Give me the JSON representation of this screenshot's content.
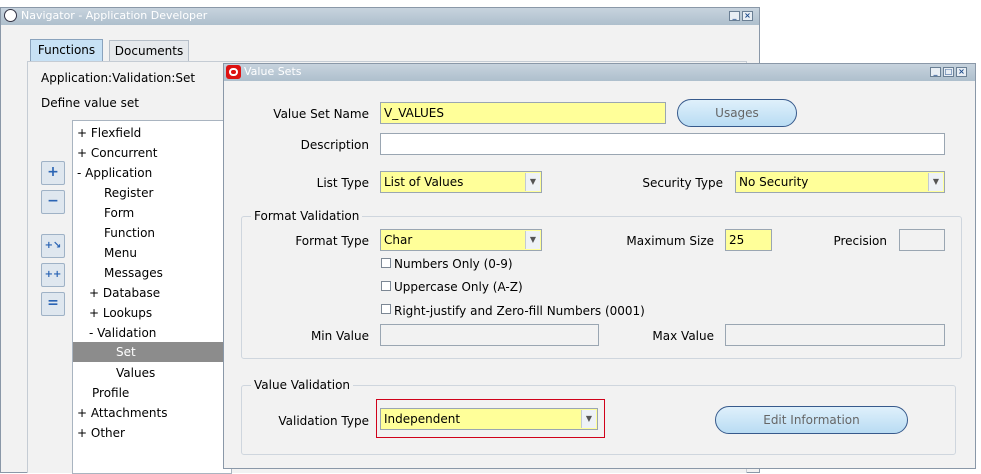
{
  "navigator": {
    "title": "Navigator - Application Developer",
    "tabs": [
      "Functions",
      "Documents"
    ],
    "path": "Application:Validation:Set",
    "description": "Define value set",
    "tree": [
      {
        "label": "+ Flexfield"
      },
      {
        "label": "+ Concurrent"
      },
      {
        "label": "- Application"
      },
      {
        "label": "Register"
      },
      {
        "label": "Form"
      },
      {
        "label": "Function"
      },
      {
        "label": "Menu"
      },
      {
        "label": "Messages"
      },
      {
        "label": "+ Database"
      },
      {
        "label": "+ Lookups"
      },
      {
        "label": "- Validation"
      },
      {
        "label": "Set"
      },
      {
        "label": "Values"
      },
      {
        "label": "Profile"
      },
      {
        "label": "+ Attachments"
      },
      {
        "label": "+ Other"
      }
    ],
    "side_buttons": [
      "plus-icon",
      "minus-icon",
      "expand-branch-icon",
      "expand-all-icon",
      "collapse-all-icon"
    ]
  },
  "value_sets": {
    "title": "Value Sets",
    "value_set_name_label": "Value Set Name",
    "value_set_name": "V_VALUES",
    "usages_button": "Usages",
    "description_label": "Description",
    "description": "",
    "list_type_label": "List Type",
    "list_type": "List of Values",
    "security_type_label": "Security Type",
    "security_type": "No Security",
    "format_validation": {
      "legend": "Format Validation",
      "format_type_label": "Format Type",
      "format_type": "Char",
      "max_size_label": "Maximum Size",
      "max_size": "25",
      "precision_label": "Precision",
      "precision": "",
      "numbers_only": "Numbers Only (0-9)",
      "uppercase_only": "Uppercase Only (A-Z)",
      "right_justify": "Right-justify and Zero-fill Numbers (0001)",
      "min_value_label": "Min Value",
      "min_value": "",
      "max_value_label": "Max Value",
      "max_value": ""
    },
    "value_validation": {
      "legend": "Value Validation",
      "validation_type_label": "Validation Type",
      "validation_type": "Independent",
      "edit_information_button": "Edit Information"
    }
  },
  "colors": {
    "required_field": "#ffff99",
    "selected_tree_item": "#8c8c8c",
    "highlight_border": "#d0021b",
    "button_fill": "#cbe6f8"
  }
}
